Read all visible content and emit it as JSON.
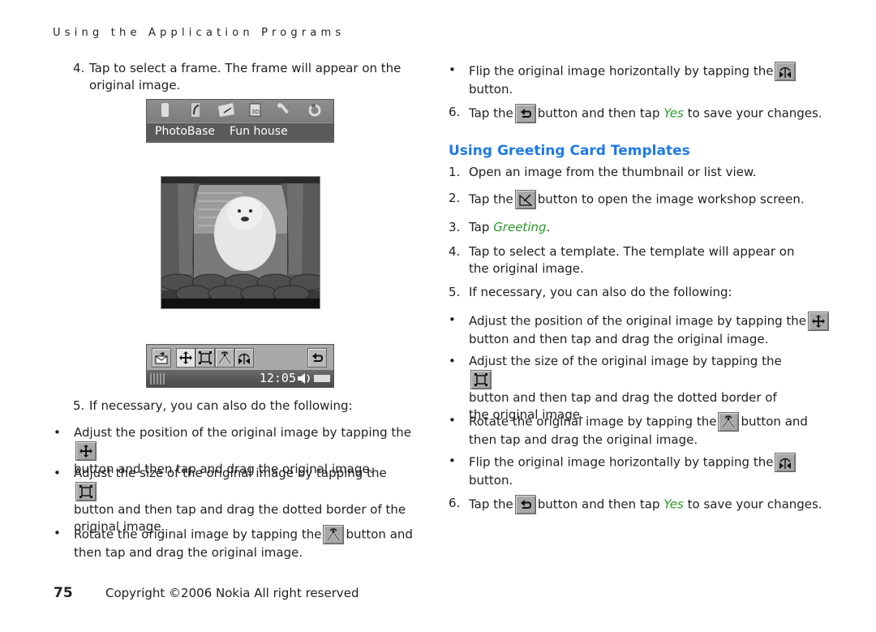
{
  "running_head": "Using the Application Programs",
  "left_column": {
    "step4": {
      "num": "4.",
      "text": "Tap to select a frame. The frame will appear on the original image."
    },
    "menu_screen": {
      "icons": [
        "phone-icon",
        "music-icon",
        "mail-icon",
        "calendar-3d-icon",
        "wrench-icon",
        "refresh-icon"
      ],
      "labels": [
        "PhotoBase",
        "Fun house"
      ]
    },
    "photo_alt": "Dog photo with curtain frame",
    "toolbar_screen": {
      "buttons": [
        "send-icon",
        "move-icon",
        "resize-icon",
        "rotate-icon",
        "flip-icon",
        "back-icon"
      ],
      "clock": "12:05"
    },
    "step5": {
      "num": "5.",
      "text": "If necessary, you can also do the following:"
    },
    "bullets": [
      {
        "before": "Adjust the position of the original image by tapping the",
        "icon": "move-icon",
        "after": "button and then tap and drag the original image."
      },
      {
        "before": "Adjust the size of the original image by tapping the",
        "icon": "resize-icon",
        "after": "button and then tap and drag the dotted border of the original image."
      },
      {
        "before": "Rotate the original image by tapping the",
        "icon": "rotate-icon",
        "after": "button and then tap and drag the original image."
      }
    ]
  },
  "right_column": {
    "flip_bullet": {
      "before": "Flip the original image horizontally by tapping the",
      "icon": "flip-icon",
      "after": "button."
    },
    "step6": {
      "num": "6.",
      "before": "Tap the",
      "after_icon": "button and then tap",
      "yes": "Yes",
      "tail": "to save your changes."
    },
    "heading": "Using Greeting Card Templates",
    "steps": [
      {
        "num": "1.",
        "text": "Open an image from the thumbnail or list view."
      },
      {
        "num": "2.",
        "before": "Tap the",
        "after": "button to open the image workshop screen."
      },
      {
        "num": "3.",
        "before": "Tap",
        "green": "Greeting",
        "after": "."
      },
      {
        "num": "4.",
        "text": "Tap to select a template. The template will appear on the original image."
      },
      {
        "num": "5.",
        "text": "If necessary, you can also do the following:"
      }
    ],
    "bullets": [
      {
        "before": "Adjust the position of the original image by tapping the",
        "after": "button and then tap and drag the original image."
      },
      {
        "before": "Adjust the size of the original image by tapping the",
        "after": "button and then tap and drag the dotted border of the original image."
      },
      {
        "before": "Rotate the original image by tapping the",
        "after": "button and then tap and drag the original image."
      },
      {
        "before": "Flip the original image horizontally by tapping the",
        "after": "button."
      }
    ]
  },
  "footer": {
    "page": "75",
    "copyright": "Copyright ©2006 Nokia All right reserved"
  },
  "colors": {
    "heading": "#1e7ae6",
    "emphasis": "#2a9a2a"
  }
}
